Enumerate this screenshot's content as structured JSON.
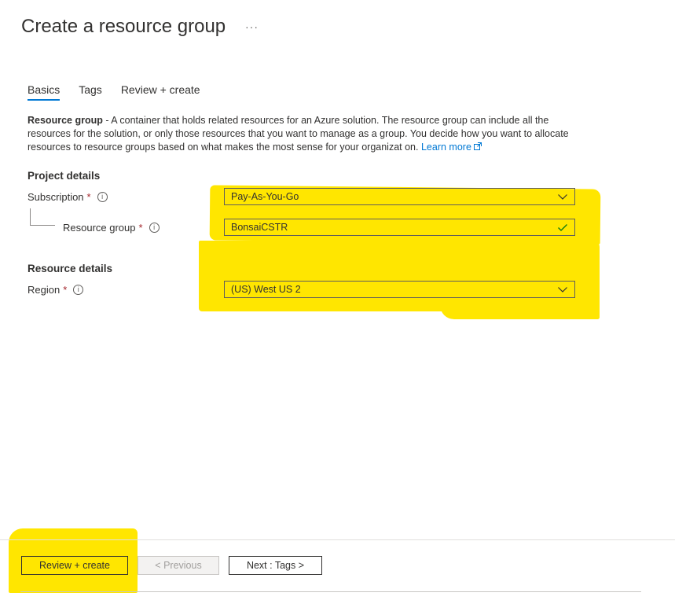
{
  "page": {
    "title": "Create a resource group",
    "more_icon": "ellipsis-icon"
  },
  "tabs": [
    {
      "label": "Basics",
      "active": true
    },
    {
      "label": "Tags",
      "active": false
    },
    {
      "label": "Review + create",
      "active": false
    }
  ],
  "description": {
    "bold": "Resource group",
    "text": " - A container that holds related resources for an Azure solution. The resource group can include all the resources for the solution, or only those resources that you want to manage as a group. You decide how you want to allocate resources to resource groups based on what makes the most sense for your organizat on. ",
    "link": "Learn more"
  },
  "project_details": {
    "heading": "Project details",
    "subscription": {
      "label": "Subscription",
      "required": "*",
      "value": "Pay-As-You-Go"
    },
    "resource_group": {
      "label": "Resource group",
      "required": "*",
      "value": "BonsaiCSTR"
    }
  },
  "resource_details": {
    "heading": "Resource details",
    "region": {
      "label": "Region",
      "required": "*",
      "value": "(US) West US 2"
    }
  },
  "footer": {
    "review_create": "Review + create",
    "previous": "< Previous",
    "next": "Next : Tags >"
  },
  "colors": {
    "accent": "#0078d4",
    "highlight": "#ffe600",
    "required": "#a4262c",
    "valid_check": "#107c10"
  }
}
